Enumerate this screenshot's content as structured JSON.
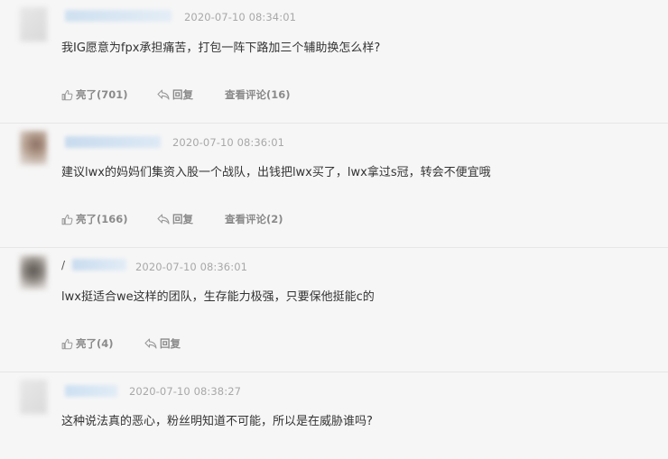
{
  "comments": [
    {
      "time": "2020-07-10 08:34:01",
      "text": "我IG愿意为fpx承担痛苦，打包一阵下路加三个辅助换怎么样?",
      "like_label": "亮了(701)",
      "reply_label": "回复",
      "view_label": "查看评论(16)"
    },
    {
      "time": "2020-07-10 08:36:01",
      "text": "建议lwx的妈妈们集资入股一个战队，出钱把lwx买了，lwx拿过s冠，转会不便宜哦",
      "like_label": "亮了(166)",
      "reply_label": "回复",
      "view_label": "查看评论(2)"
    },
    {
      "time": "2020-07-10 08:36:01",
      "name_prefix": "/",
      "text": "lwx挺适合we这样的团队，生存能力极强，只要保他挺能c的",
      "like_label": "亮了(4)",
      "reply_label": "回复"
    },
    {
      "time": "2020-07-10 08:38:27",
      "text": "这种说法真的恶心，粉丝明知道不可能，所以是在威胁谁吗?"
    }
  ],
  "icons": {
    "like": "thumbs-up-icon",
    "reply": "reply-arrow-icon"
  }
}
